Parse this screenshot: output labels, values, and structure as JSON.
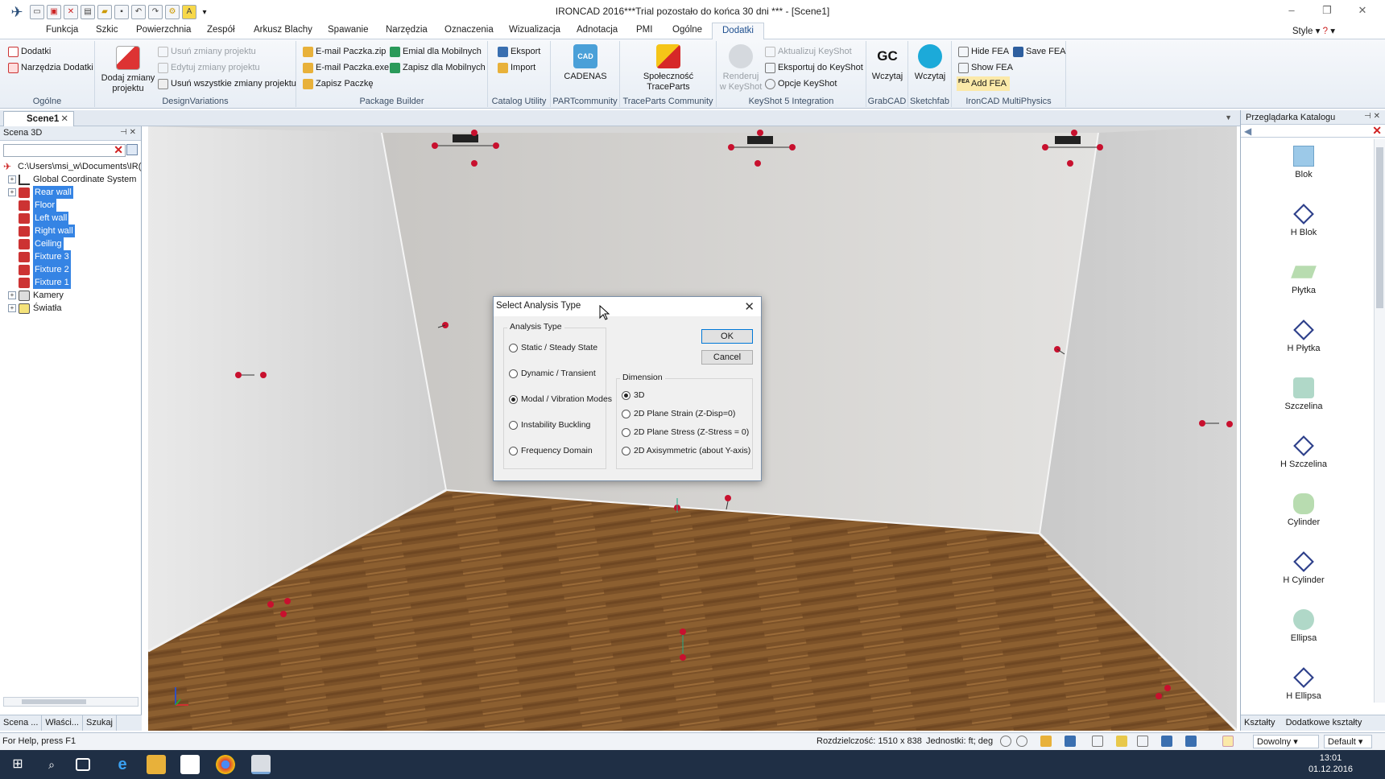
{
  "window": {
    "title": "IRONCAD 2016***Trial pozostało do końca 30 dni *** - [Scene1]",
    "style_label": "Style",
    "controls": [
      "–",
      "❐",
      "✕"
    ]
  },
  "menu_tabs": [
    "Funkcja",
    "Szkic",
    "Powierzchnia",
    "Zespół",
    "Arkusz Blachy",
    "Spawanie",
    "Narzędzia",
    "Oznaczenia",
    "Wizualizacja",
    "Adnotacja",
    "PMI",
    "Ogólne",
    "Dodatki"
  ],
  "active_tab": "Dodatki",
  "ribbon": {
    "ogolne": {
      "label": "Ogólne",
      "items": [
        "Dodatki",
        "Narzędzia Dodatki"
      ]
    },
    "designvariations": {
      "label": "DesignVariations",
      "big_button": "Dodaj zmiany projektu",
      "big_line1": "Dodaj zmiany",
      "big_line2": "projektu",
      "items": [
        "Usuń zmiany projektu",
        "Edytuj zmiany projektu",
        "Usuń wszystkie zmiany projektu"
      ]
    },
    "package_builder": {
      "label": "Package Builder",
      "items": [
        "E-mail Paczka.zip",
        "E-mail Paczka.exe",
        "Zapisz Paczkę",
        "Emial dla Mobilnych",
        "Zapisz dla Mobilnych"
      ]
    },
    "catalog_utility": {
      "label": "Catalog Utility",
      "items": [
        "Eksport",
        "Import"
      ]
    },
    "partcommunity": {
      "label": "PARTcommunity",
      "big_button": "CADENAS",
      "icon_text": "CAD"
    },
    "traceparts": {
      "label": "TraceParts Community",
      "line1": "Społeczność",
      "line2": "TraceParts"
    },
    "keyshot": {
      "label": "KeyShot 5 Integration",
      "big_line1": "Renderuj",
      "big_line2": "w KeyShot",
      "items": [
        "Aktualizuj KeyShot",
        "Eksportuj do KeyShot",
        "Opcje KeyShot"
      ]
    },
    "grabcad": {
      "label": "GrabCAD",
      "big_button": "Wczytaj",
      "icon_text": "GC"
    },
    "sketchfab": {
      "label": "Sketchfab",
      "big_button": "Wczytaj"
    },
    "multiphysics": {
      "label": "IronCAD MultiPhysics",
      "items": [
        "Hide FEA",
        "Show FEA",
        "Add FEA",
        "Save FEA"
      ]
    }
  },
  "document_tab": "Scene1",
  "scene_panel": {
    "title": "Scena 3D",
    "root_path": "C:\\Users\\msi_w\\Documents\\IR(",
    "items": [
      {
        "label": "Global Coordinate System",
        "selected": false
      },
      {
        "label": "Rear wall",
        "selected": true
      },
      {
        "label": "Floor",
        "selected": true
      },
      {
        "label": "Left wall",
        "selected": true
      },
      {
        "label": "Right wall",
        "selected": true
      },
      {
        "label": "Ceiling",
        "selected": true
      },
      {
        "label": "Fixture 3",
        "selected": true
      },
      {
        "label": "Fixture 2",
        "selected": true
      },
      {
        "label": "Fixture 1",
        "selected": true
      },
      {
        "label": "Kamery",
        "selected": false
      },
      {
        "label": "Światła",
        "selected": false
      }
    ],
    "bottom_tabs": [
      "Scena ...",
      "Właści...",
      "Szukaj"
    ]
  },
  "catalog_panel": {
    "title": "Przeglądarka Katalogu",
    "items": [
      "Blok",
      "H Blok",
      "Płytka",
      "H Płytka",
      "Szczelina",
      "H Szczelina",
      "Cylinder",
      "H Cylinder",
      "Ellipsa",
      "H Ellipsa"
    ],
    "bottom_tabs": [
      "Kształty",
      "Dodatkowe kształty"
    ]
  },
  "dialog": {
    "title": "Select Analysis Type",
    "analysis_group": "Analysis Type",
    "analysis_options": [
      "Static / Steady State",
      "Dynamic / Transient",
      "Modal / Vibration Modes",
      "Instability Buckling",
      "Frequency Domain"
    ],
    "analysis_selected": 2,
    "dimension_group": "Dimension",
    "dimension_options": [
      "3D",
      "2D Plane Strain (Z-Disp=0)",
      "2D Plane Stress (Z-Stress = 0)",
      "2D Axisymmetric (about Y-axis)"
    ],
    "dimension_selected": 0,
    "ok": "OK",
    "cancel": "Cancel"
  },
  "status": {
    "help": "For Help, press F1",
    "resolution": "Rozdzielczość: 1510 x 838",
    "units": "Jednostki: ft; deg",
    "dropdown1": "Dowolny",
    "dropdown2": "Default"
  },
  "taskbar": {
    "time": "13:01",
    "date": "01.12.2016"
  },
  "colors": {
    "selection": "#3584e4",
    "accent": "#1e4f8f",
    "marker": "#c8102e",
    "floor": "#8a5a2b"
  }
}
